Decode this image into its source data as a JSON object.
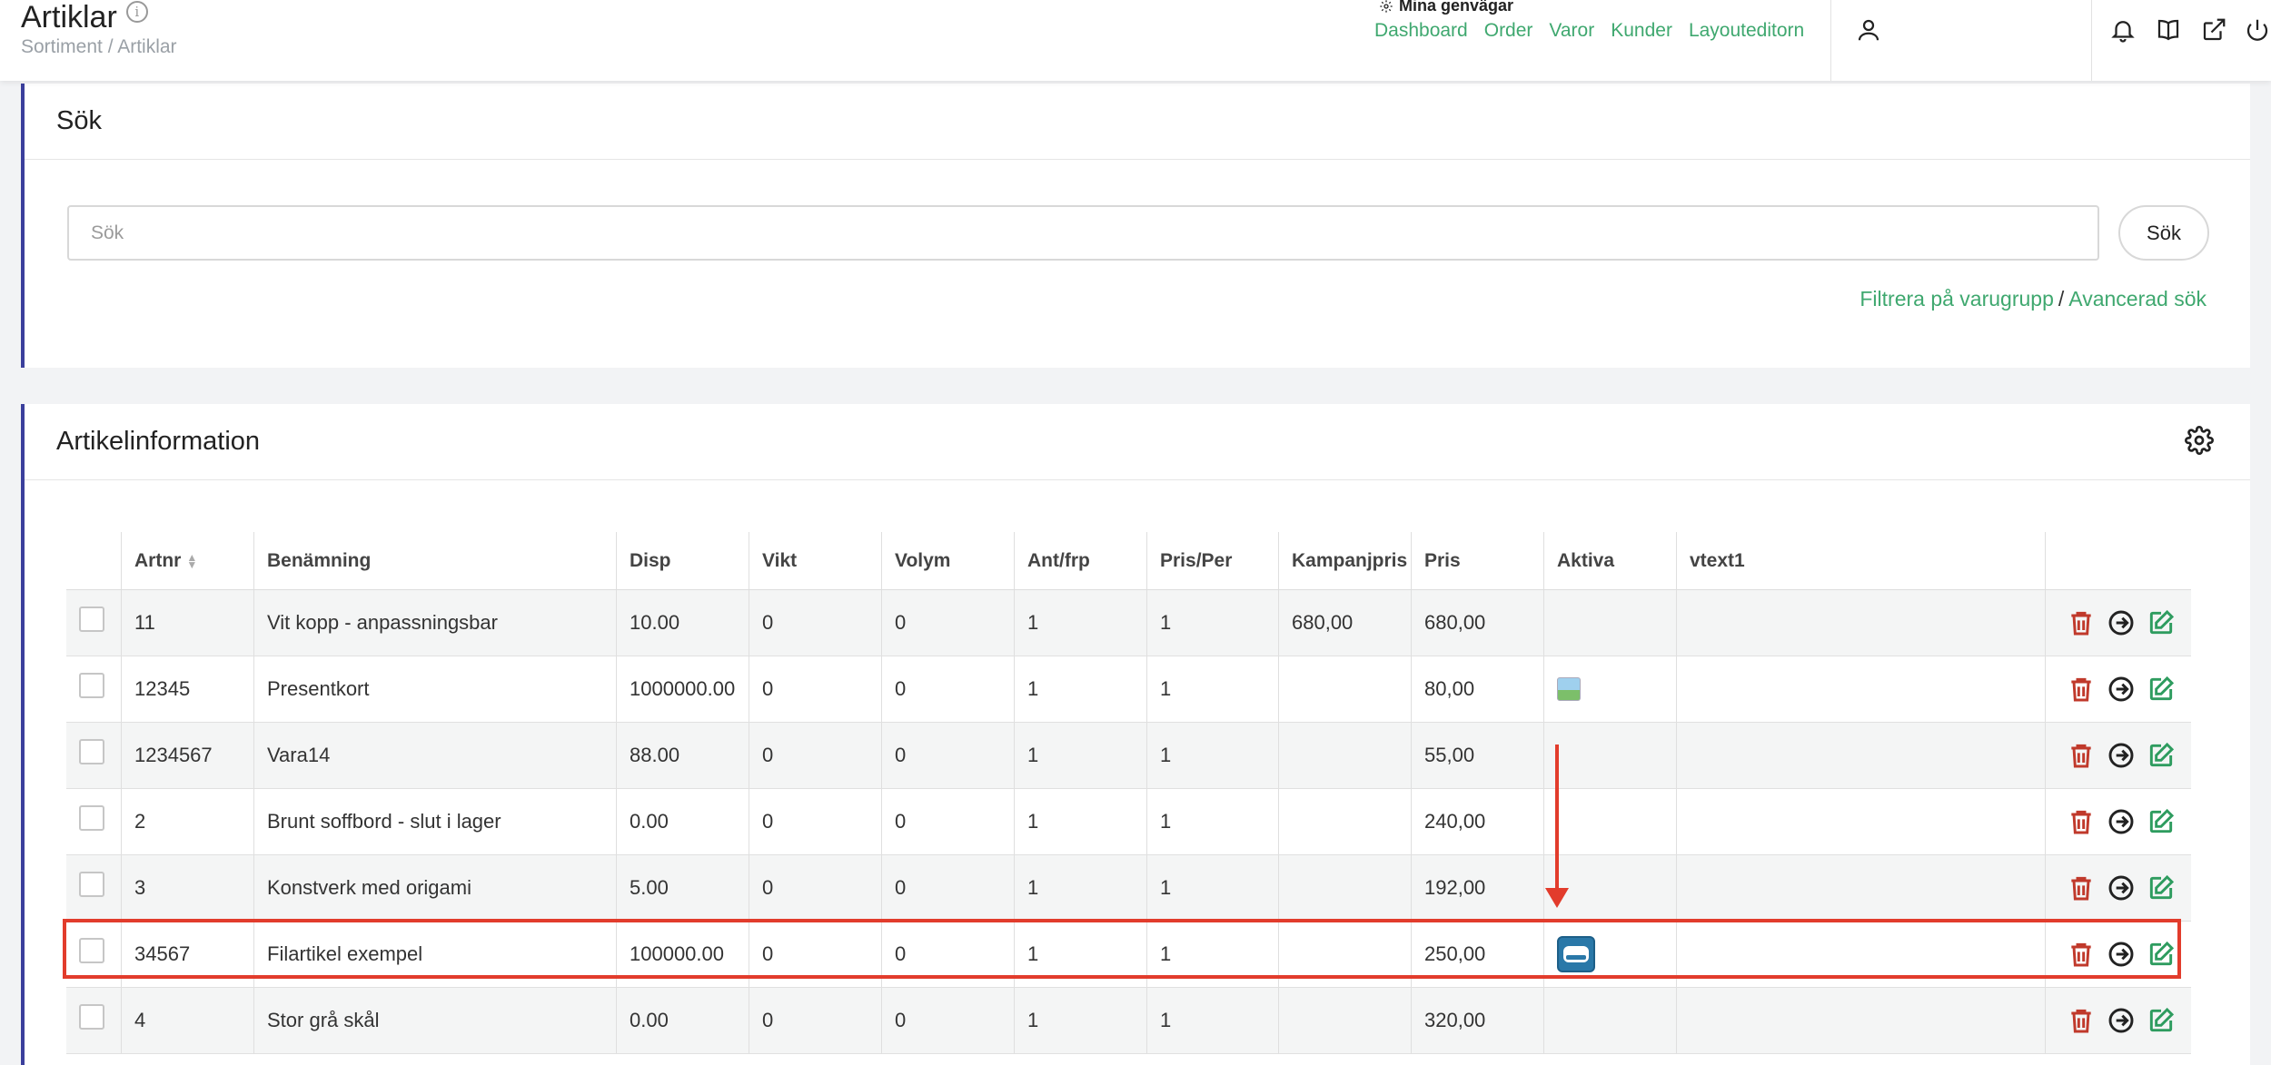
{
  "header": {
    "title": "Artiklar",
    "breadcrumb": "Sortiment / Artiklar",
    "shortcuts_title": "Mina genvägar",
    "shortcuts": [
      "Dashboard",
      "Order",
      "Varor",
      "Kunder",
      "Layouteditorn"
    ]
  },
  "search": {
    "title": "Sök",
    "placeholder": "Sök",
    "button": "Sök",
    "filter_link": "Filtrera på varugrupp",
    "separator": "/",
    "advanced_link": "Avancerad sök"
  },
  "articles": {
    "title": "Artikelinformation",
    "columns": [
      "Artnr",
      "Benämning",
      "Disp",
      "Vikt",
      "Volym",
      "Ant/frp",
      "Pris/Per",
      "Kampanjpris",
      "Pris",
      "Aktiva",
      "vtext1"
    ],
    "rows": [
      {
        "artnr": "11",
        "name": "Vit kopp - anpassningsbar",
        "disp": "10.00",
        "vikt": "0",
        "volym": "0",
        "antfrp": "1",
        "prisper": "1",
        "kampanjpris": "680,00",
        "pris": "680,00",
        "aktiva": "",
        "vtext1": ""
      },
      {
        "artnr": "12345",
        "name": "Presentkort",
        "disp": "1000000.00",
        "vikt": "0",
        "volym": "0",
        "antfrp": "1",
        "prisper": "1",
        "kampanjpris": "",
        "pris": "80,00",
        "aktiva": "image-thumbnail-icon",
        "vtext1": ""
      },
      {
        "artnr": "1234567",
        "name": "Vara14",
        "disp": "88.00",
        "vikt": "0",
        "volym": "0",
        "antfrp": "1",
        "prisper": "1",
        "kampanjpris": "",
        "pris": "55,00",
        "aktiva": "",
        "vtext1": ""
      },
      {
        "artnr": "2",
        "name": "Brunt soffbord - slut i lager",
        "disp": "0.00",
        "vikt": "0",
        "volym": "0",
        "antfrp": "1",
        "prisper": "1",
        "kampanjpris": "",
        "pris": "240,00",
        "aktiva": "",
        "vtext1": ""
      },
      {
        "artnr": "3",
        "name": "Konstverk med origami",
        "disp": "5.00",
        "vikt": "0",
        "volym": "0",
        "antfrp": "1",
        "prisper": "1",
        "kampanjpris": "",
        "pris": "192,00",
        "aktiva": "",
        "vtext1": ""
      },
      {
        "artnr": "34567",
        "name": "Filartikel exempel",
        "disp": "100000.00",
        "vikt": "0",
        "volym": "0",
        "antfrp": "1",
        "prisper": "1",
        "kampanjpris": "",
        "pris": "250,00",
        "aktiva": "file-thumbnail-icon",
        "vtext1": ""
      },
      {
        "artnr": "4",
        "name": "Stor grå skål",
        "disp": "0.00",
        "vikt": "0",
        "volym": "0",
        "antfrp": "1",
        "prisper": "1",
        "kampanjpris": "",
        "pris": "320,00",
        "aktiva": "",
        "vtext1": ""
      }
    ]
  },
  "colors": {
    "accent": "#3fa86f",
    "card_border": "#3b3f9c",
    "delete": "#c0392b",
    "annotation": "#e23c2c"
  }
}
